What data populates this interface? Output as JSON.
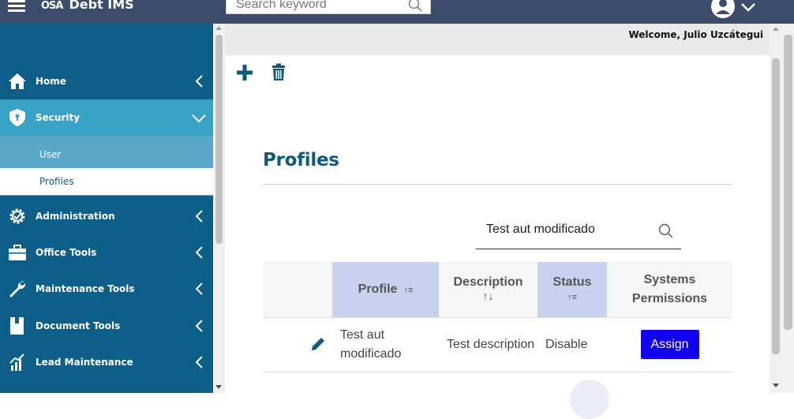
{
  "topbar": {
    "logo_mark": "OSA",
    "app_name": "Debt IMS",
    "search_placeholder": "Search keyword"
  },
  "header": {
    "welcome": "Welcome, Julio Uzcátegui"
  },
  "sidebar": {
    "items": [
      {
        "label": "Home",
        "icon": "home-icon"
      },
      {
        "label": "Security",
        "icon": "shield-icon",
        "expanded": true,
        "children": [
          {
            "label": "User"
          },
          {
            "label": "Profiles",
            "active": true
          }
        ]
      },
      {
        "label": "Administration",
        "icon": "gear-icon"
      },
      {
        "label": "Office Tools",
        "icon": "briefcase-icon"
      },
      {
        "label": "Maintenance Tools",
        "icon": "wrench-icon"
      },
      {
        "label": "Document Tools",
        "icon": "book-icon"
      },
      {
        "label": "Lead Maintenance",
        "icon": "chart-icon"
      }
    ]
  },
  "main": {
    "title": "Profiles",
    "search_value": "Test aut modificado",
    "table": {
      "columns": [
        "Profile",
        "Description",
        "Status",
        "Systems Permissions"
      ],
      "rows": [
        {
          "profile": "Test aut modificado",
          "description": "Test description",
          "status": "Disable",
          "action": "Assign"
        }
      ]
    }
  },
  "colors": {
    "topbar": "#3c4d6b",
    "sidebar": "#0d5f8a",
    "sidebar_active": "#39a3c6",
    "title": "#0f5a80",
    "assign_button": "#1400f0",
    "sorted_header": "#c7d3ee"
  }
}
